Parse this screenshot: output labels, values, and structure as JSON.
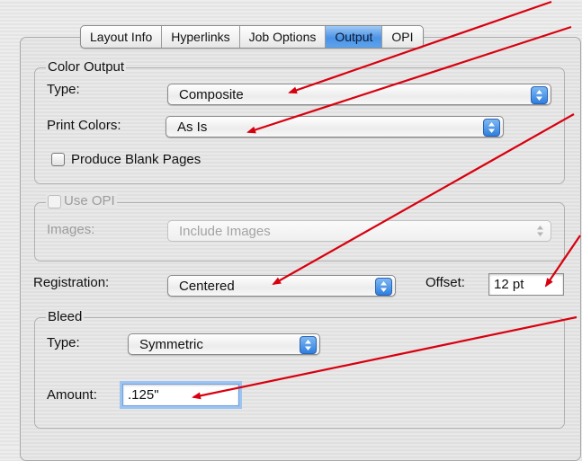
{
  "tabs": [
    {
      "label": "Layout Info",
      "active": false
    },
    {
      "label": "Hyperlinks",
      "active": false
    },
    {
      "label": "Job Options",
      "active": false
    },
    {
      "label": "Output",
      "active": true
    },
    {
      "label": "OPI",
      "active": false
    }
  ],
  "color_output": {
    "legend": "Color Output",
    "type_label": "Type:",
    "type_value": "Composite",
    "print_colors_label": "Print Colors:",
    "print_colors_value": "As Is",
    "blank_pages_label": "Produce Blank Pages"
  },
  "opi": {
    "legend": "Use OPI",
    "images_label": "Images:",
    "images_value": "Include Images"
  },
  "registration": {
    "label": "Registration:",
    "value": "Centered",
    "offset_label": "Offset:",
    "offset_value": "12 pt"
  },
  "bleed": {
    "legend": "Bleed",
    "type_label": "Type:",
    "type_value": "Symmetric",
    "amount_label": "Amount:",
    "amount_value": ".125\""
  },
  "colors": {
    "accent": "#4b93e6",
    "annotation_arrow": "#d8000f"
  },
  "icons": {
    "popup_arrows": "updown-arrows-icon",
    "annotation": "red-arrow-icon"
  }
}
